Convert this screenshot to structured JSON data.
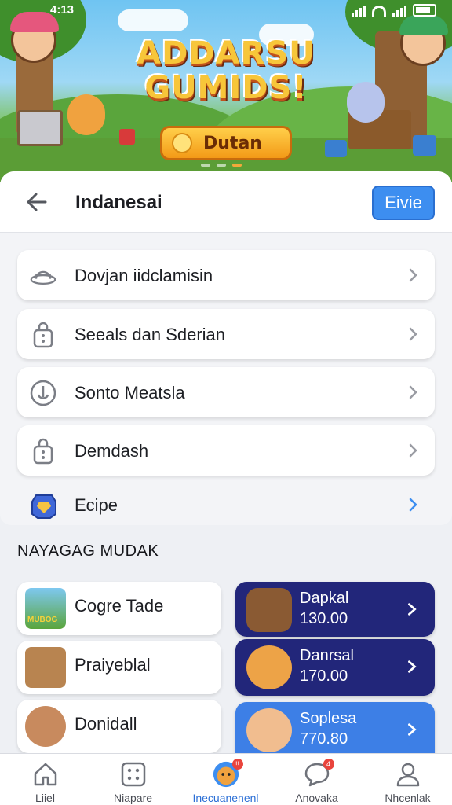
{
  "status_bar": {
    "time": "4:13"
  },
  "banner": {
    "game_title_line1": "ADDARSU",
    "game_title_line2": "GUMIDS!",
    "button_label": "Dutan"
  },
  "header": {
    "title": "Indanesai",
    "action_label": "Eivie"
  },
  "menu": {
    "items": [
      {
        "label": "Dovjan iidclamisin",
        "icon": "hat-icon"
      },
      {
        "label": "Seeals dan Sderian",
        "icon": "lock-icon"
      },
      {
        "label": "Sonto Meatsla",
        "icon": "anchor-icon"
      },
      {
        "label": "Demdash",
        "icon": "lock-icon"
      }
    ],
    "plain_item": {
      "label": "Ecipe",
      "icon": "gem-icon"
    }
  },
  "section": {
    "title": "NAYAGAG MUDAK"
  },
  "list_cards": [
    {
      "label": "Cogre Tade",
      "thumb_text": "MUBOG"
    },
    {
      "label": "Praiyeblal"
    },
    {
      "label": "Donidall"
    }
  ],
  "promos": [
    {
      "name": "Dapkal",
      "value": "130.00"
    },
    {
      "name": "Danrsal",
      "value": "170.00"
    },
    {
      "name": "Soplesa",
      "value": "770.80"
    }
  ],
  "bottom_nav": [
    {
      "label": "Liiel",
      "icon": "home-icon"
    },
    {
      "label": "Niapare",
      "icon": "grid-icon"
    },
    {
      "label": "Inecuanenenl",
      "icon": "mascot-icon",
      "badge": "!!"
    },
    {
      "label": "Anovaka",
      "icon": "chat-icon",
      "badge": "4"
    },
    {
      "label": "Nhcenlak",
      "icon": "profile-icon"
    }
  ],
  "colors": {
    "accent": "#3d8ef0",
    "promo_dark": "#22267a",
    "promo_light": "#3d7fe6",
    "nav_active": "#2b6fd6"
  }
}
